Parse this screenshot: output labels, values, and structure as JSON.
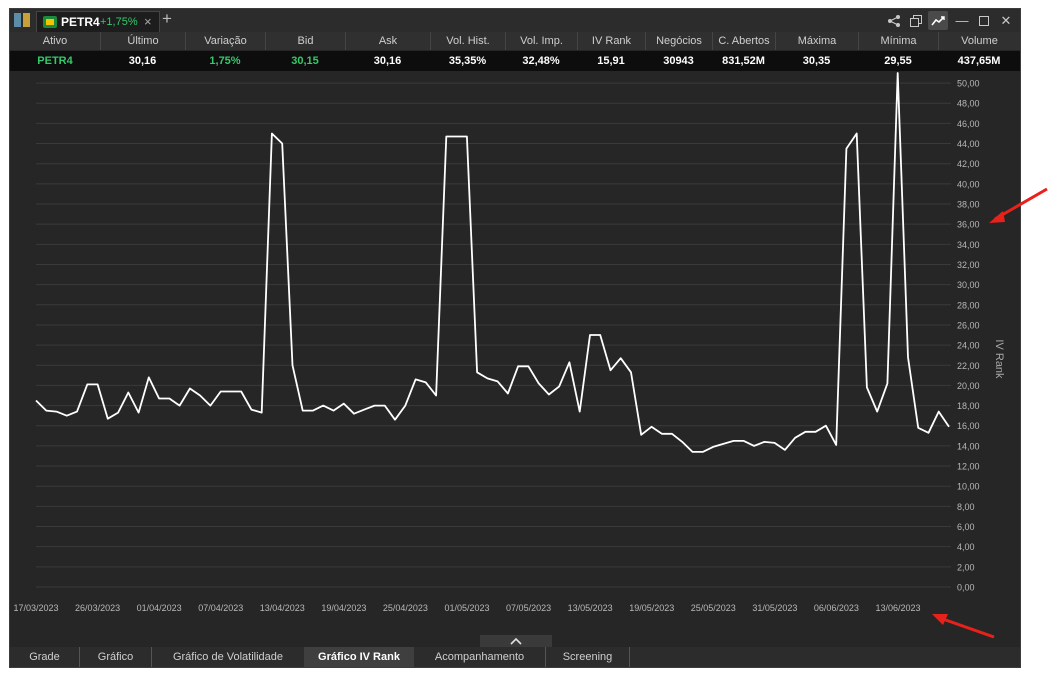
{
  "tab": {
    "symbol": "PETR4",
    "change": "+1,75%",
    "close": "×"
  },
  "add_tab": "+",
  "window_buttons": {
    "minimize": "—",
    "close": "✕"
  },
  "quote": {
    "headers": [
      "Ativo",
      "Último",
      "Variação",
      "Bid",
      "Ask",
      "Vol. Hist.",
      "Vol. Imp.",
      "IV Rank",
      "Negócios",
      "C. Abertos",
      "Máxima",
      "Mínima",
      "Volume"
    ],
    "values": [
      "PETR4",
      "30,16",
      "1,75%",
      "30,15",
      "30,16",
      "35,35%",
      "32,48%",
      "15,91",
      "30943",
      "831,52M",
      "30,35",
      "29,55",
      "437,65M"
    ]
  },
  "chart_data": {
    "type": "line",
    "ylabel": "IV Rank",
    "ylim": [
      0,
      51
    ],
    "y_ticks": [
      "0,00",
      "2,00",
      "4,00",
      "6,00",
      "8,00",
      "10,00",
      "12,00",
      "14,00",
      "16,00",
      "18,00",
      "20,00",
      "22,00",
      "24,00",
      "26,00",
      "28,00",
      "30,00",
      "32,00",
      "34,00",
      "36,00",
      "38,00",
      "40,00",
      "42,00",
      "44,00",
      "46,00",
      "48,00",
      "50,00"
    ],
    "x_ticks": [
      "17/03/2023",
      "26/03/2023",
      "01/04/2023",
      "07/04/2023",
      "13/04/2023",
      "19/04/2023",
      "25/04/2023",
      "01/05/2023",
      "07/05/2023",
      "13/05/2023",
      "19/05/2023",
      "25/05/2023",
      "31/05/2023",
      "06/06/2023",
      "13/06/2023"
    ],
    "series": [
      {
        "color": "#ffffff",
        "values": [
          18.5,
          17.5,
          17.4,
          17.0,
          17.4,
          20.1,
          20.1,
          16.7,
          17.3,
          19.3,
          17.3,
          20.8,
          18.7,
          18.7,
          18.0,
          19.7,
          19.0,
          18.0,
          19.4,
          19.4,
          19.4,
          17.6,
          17.3,
          45.0,
          44.0,
          22.0,
          17.5,
          17.5,
          18.0,
          17.5,
          18.2,
          17.2,
          17.6,
          18.0,
          18.0,
          16.6,
          18.0,
          20.6,
          20.3,
          19.0,
          44.7,
          44.7,
          44.7,
          21.3,
          20.7,
          20.4,
          19.2,
          21.9,
          21.9,
          20.2,
          19.1,
          19.9,
          22.3,
          17.4,
          25.0,
          25.0,
          21.5,
          22.7,
          21.3,
          15.1,
          15.9,
          15.2,
          15.2,
          14.4,
          13.4,
          13.4,
          13.9,
          14.2,
          14.5,
          14.5,
          14.0,
          14.4,
          14.3,
          13.6,
          14.8,
          15.4,
          15.4,
          16.0,
          14.1,
          43.5,
          45.0,
          19.8,
          17.4,
          20.2,
          51.0,
          22.8,
          15.8,
          15.3,
          17.4,
          15.9
        ]
      }
    ]
  },
  "bottom_tabs": [
    "Grade",
    "Gráfico",
    "Gráfico de Volatilidade",
    "Gráfico IV Rank",
    "Acompanhamento",
    "Screening"
  ],
  "active_bottom_tab": "Gráfico IV Rank",
  "colors": {
    "background": "#262626",
    "grid": "#3a3a3a",
    "line": "#ffffff",
    "positive": "#34c96a",
    "annotation_arrow": "#e8221b"
  }
}
